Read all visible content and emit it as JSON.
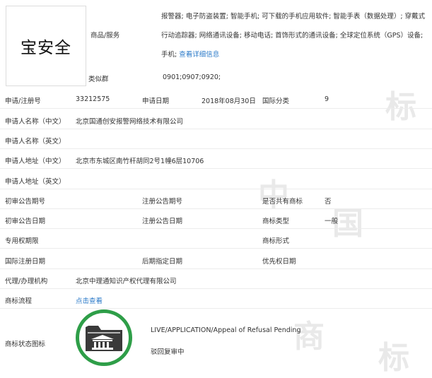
{
  "trademark_name": "宝安全",
  "goods_services": {
    "label": "商品/服务",
    "text": "报警器; 电子防盗装置; 智能手机; 可下载的手机应用软件; 智能手表（数据处理）; 穿戴式行动追踪器; 网络通讯设备; 移动电话; 首饰形式的通讯设备; 全球定位系统（GPS）设备; 手机;",
    "detail_link": "查看详细信息"
  },
  "similar_group": {
    "label": "类似群",
    "value": "0901;0907;0920;"
  },
  "fields": {
    "reg_no_label": "申请/注册号",
    "reg_no": "33212575",
    "app_date_label": "申请日期",
    "app_date": "2018年08月30日",
    "intl_class_label": "国际分类",
    "intl_class": "9",
    "applicant_cn_label": "申请人名称（中文）",
    "applicant_cn": "北京国通创安报警网络技术有限公司",
    "applicant_en_label": "申请人名称（英文）",
    "address_cn_label": "申请人地址（中文）",
    "address_cn": "北京市东城区南竹杆胡同2号1幢6层10706",
    "address_en_label": "申请人地址（英文）",
    "prelim_no_label": "初审公告期号",
    "reg_ann_no_label": "注册公告期号",
    "shared_label": "是否共有商标",
    "shared": "否",
    "prelim_date_label": "初审公告日期",
    "reg_ann_date_label": "注册公告日期",
    "tm_type_label": "商标类型",
    "tm_type": "一般",
    "excl_period_label": "专用权期限",
    "tm_form_label": "商标形式",
    "intl_reg_date_label": "国际注册日期",
    "later_date_label": "后期指定日期",
    "priority_date_label": "优先权日期",
    "agent_label": "代理/办理机构",
    "agent": "北京中理通知识产权代理有限公司",
    "process_label": "商标流程",
    "process_link": "点击查看",
    "status_label": "商标状态图标",
    "status_en": "LIVE/APPLICATION/Appeal of Refusal Pending",
    "status_cn": "驳回复审中"
  },
  "watermark_chars": [
    "标",
    "中",
    "国",
    "商",
    "标"
  ],
  "colors": {
    "status_ring": "#2e9e48",
    "link": "#2a79c8"
  },
  "icons": {
    "status": "folder-building-icon"
  }
}
